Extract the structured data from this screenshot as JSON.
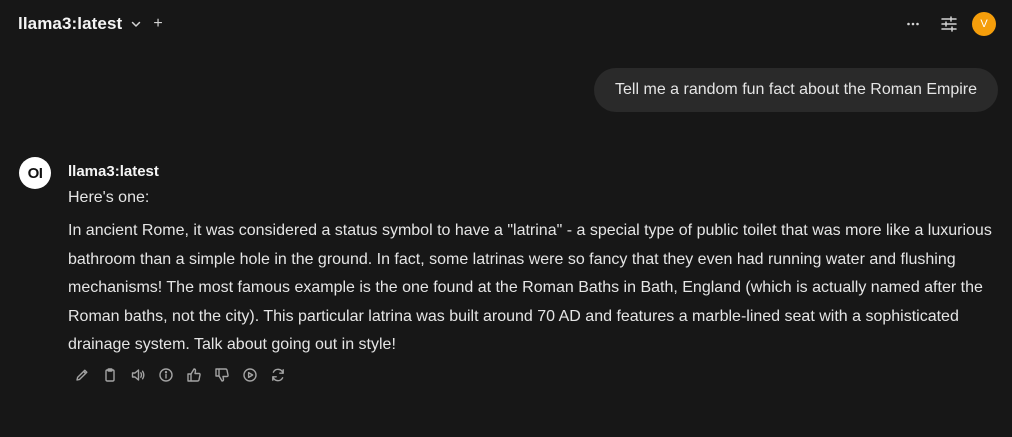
{
  "header": {
    "model_name": "llama3:latest",
    "add_label": "+",
    "avatar_initial": "V"
  },
  "chat": {
    "user_message": "Tell me a random fun fact about the Roman Empire",
    "assistant": {
      "avatar_text": "OI",
      "name": "llama3:latest",
      "intro": "Here's one:",
      "body": "In ancient Rome, it was considered a status symbol to have a \"latrina\" - a special type of public toilet that was more like a luxurious bathroom than a simple hole in the ground. In fact, some latrinas were so fancy that they even had running water and flushing mechanisms! The most famous example is the one found at the Roman Baths in Bath, England (which is actually named after the Roman baths, not the city). This particular latrina was built around 70 AD and features a marble-lined seat with a sophisticated drainage system. Talk about going out in style!"
    },
    "action_icons": [
      "edit-icon",
      "copy-icon",
      "speaker-icon",
      "info-icon",
      "thumbs-up-icon",
      "thumbs-down-icon",
      "play-icon",
      "regenerate-icon"
    ]
  },
  "colors": {
    "background": "#171717",
    "bubble": "#2a2a2a",
    "avatar": "#f59e0b",
    "text": "#e5e5e5",
    "icon": "#a3a3a3"
  }
}
